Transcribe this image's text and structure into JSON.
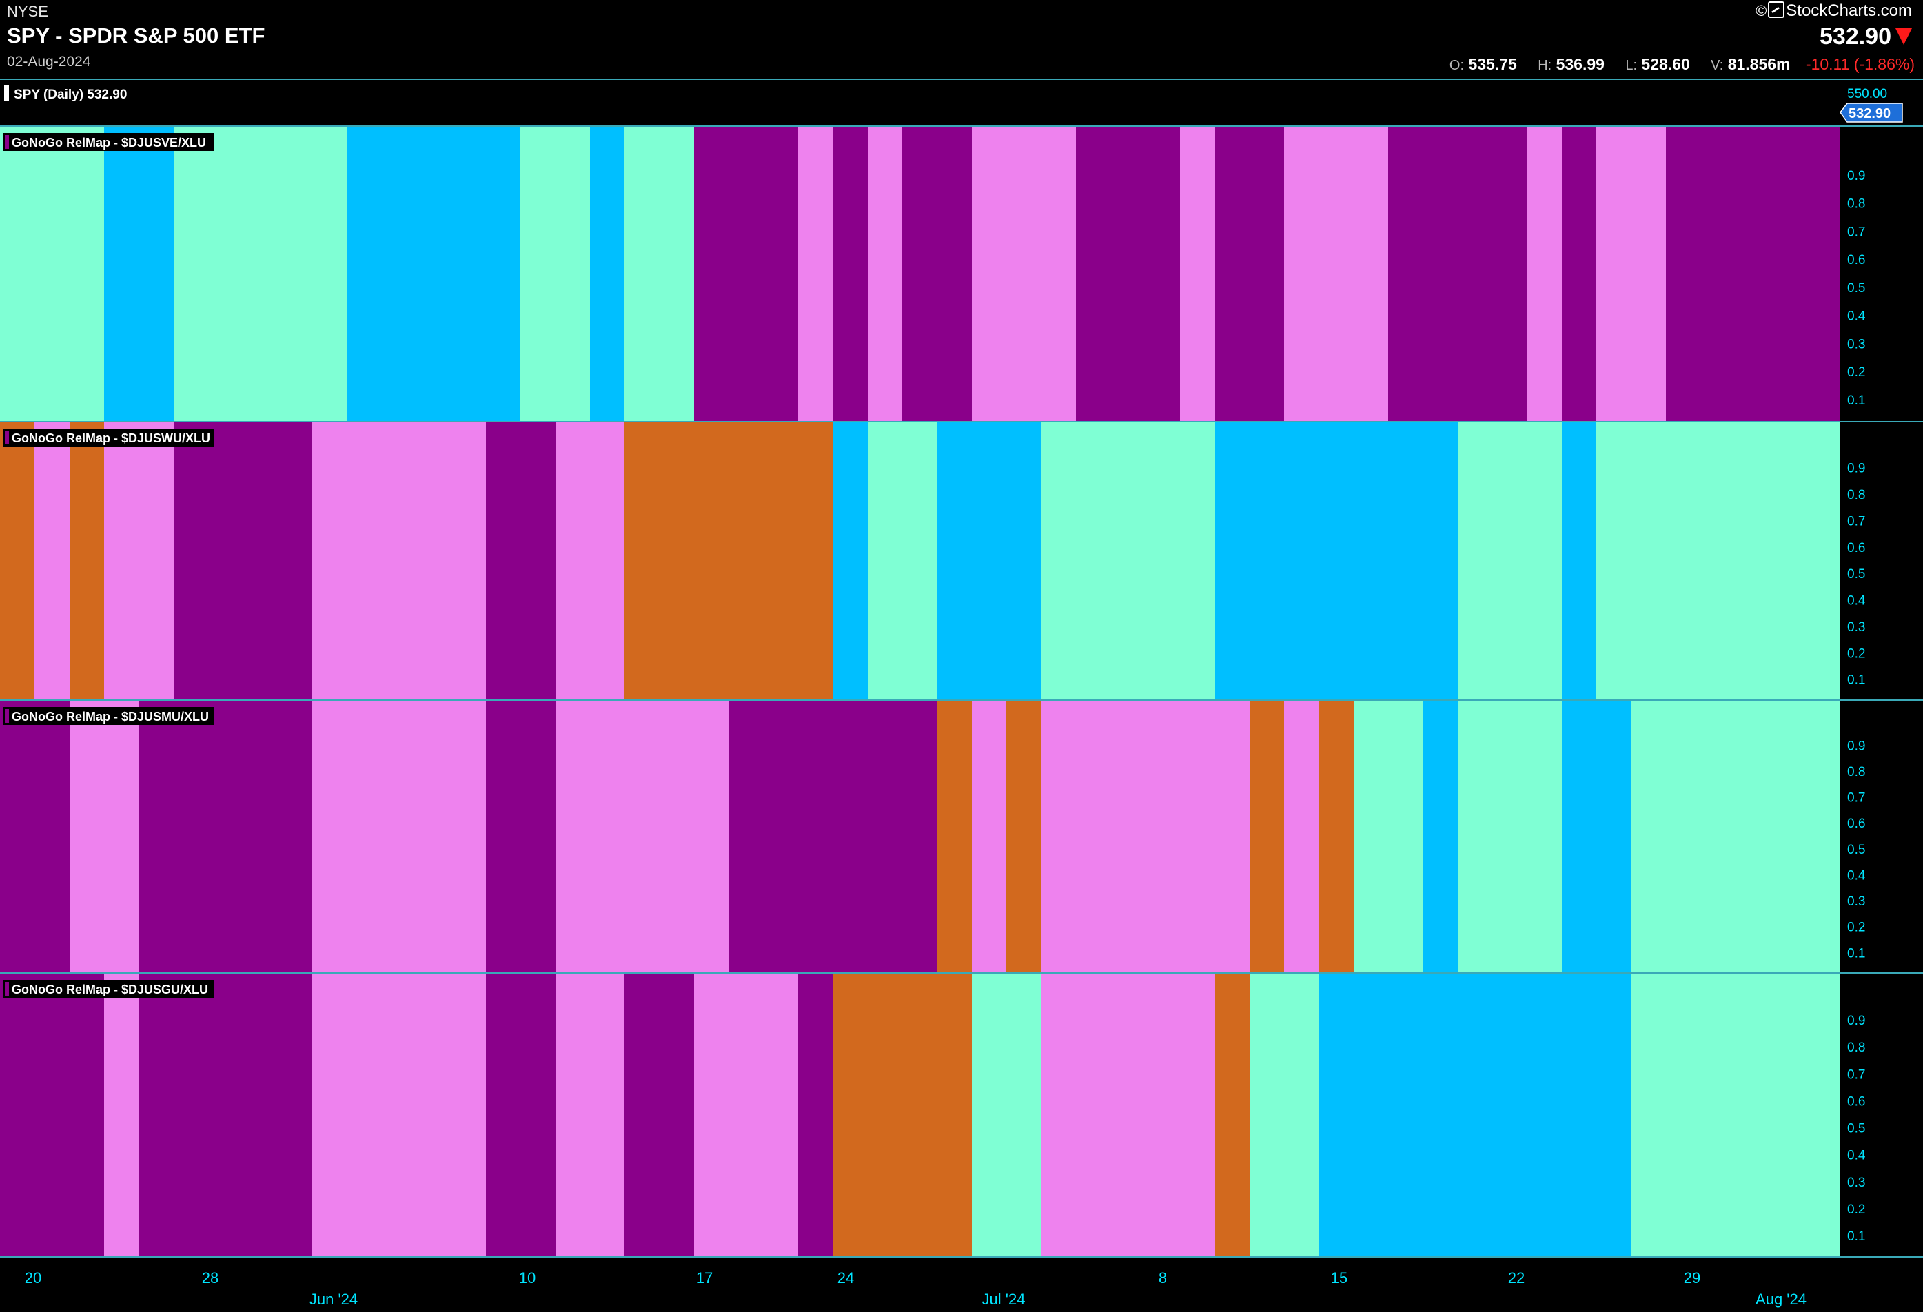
{
  "header": {
    "exchange": "NYSE",
    "title": "SPY - SPDR S&P 500 ETF",
    "date": "02-Aug-2024",
    "brand": "StockCharts.com",
    "last": "532.90",
    "open_label": "O:",
    "open": "535.75",
    "high_label": "H:",
    "high": "536.99",
    "low_label": "L:",
    "low": "528.60",
    "volume_label": "V:",
    "volume": "81.856m",
    "change": "-10.11 (-1.86%)"
  },
  "colors": {
    "purple": "#8a008a",
    "pink": "#ee82ee",
    "aqua": "#7fffd4",
    "blue": "#00bfff",
    "orange": "#d2691e",
    "axis_text": "#00e5ff",
    "price_tag": "#1e6fd9"
  },
  "chart_data": {
    "type": "heatmap",
    "price_panel": {
      "label": "SPY (Daily) 532.90",
      "axis_top": "550.00",
      "last_tag": "532.90"
    },
    "x_ticks": [
      "20",
      "28",
      "Jun '24",
      "10",
      "17",
      "24",
      "Jul '24",
      "8",
      "15",
      "22",
      "29",
      "Aug '24"
    ],
    "y_ticks": [
      "0.9",
      "0.8",
      "0.7",
      "0.6",
      "0.5",
      "0.4",
      "0.3",
      "0.2",
      "0.1"
    ],
    "panels": [
      {
        "name": "GoNoGo RelMap - $DJUSVE/XLU",
        "cells": [
          "aqua",
          "aqua",
          "aqua",
          "blue",
          "blue",
          "aqua",
          "aqua",
          "aqua",
          "aqua",
          "aqua",
          "blue",
          "blue",
          "blue",
          "blue",
          "blue",
          "aqua",
          "aqua",
          "blue",
          "aqua",
          "aqua",
          "purple",
          "purple",
          "purple",
          "pink",
          "purple",
          "pink",
          "purple",
          "purple",
          "pink",
          "pink",
          "pink",
          "purple",
          "purple",
          "purple",
          "pink",
          "purple",
          "purple",
          "pink",
          "pink",
          "pink",
          "purple",
          "purple",
          "purple",
          "purple",
          "pink",
          "purple",
          "pink",
          "pink",
          "purple",
          "purple",
          "purple",
          "purple",
          "purple"
        ]
      },
      {
        "name": "GoNoGo RelMap - $DJUSWU/XLU",
        "cells": [
          "orange",
          "pink",
          "orange",
          "pink",
          "pink",
          "purple",
          "purple",
          "purple",
          "purple",
          "pink",
          "pink",
          "pink",
          "pink",
          "pink",
          "purple",
          "purple",
          "pink",
          "pink",
          "orange",
          "orange",
          "orange",
          "orange",
          "orange",
          "orange",
          "blue",
          "aqua",
          "aqua",
          "blue",
          "blue",
          "blue",
          "aqua",
          "aqua",
          "aqua",
          "aqua",
          "aqua",
          "blue",
          "blue",
          "blue",
          "blue",
          "blue",
          "blue",
          "blue",
          "aqua",
          "aqua",
          "aqua",
          "blue",
          "aqua",
          "aqua",
          "aqua",
          "aqua",
          "aqua",
          "aqua",
          "aqua"
        ]
      },
      {
        "name": "GoNoGo RelMap - $DJUSMU/XLU",
        "cells": [
          "purple",
          "purple",
          "pink",
          "pink",
          "purple",
          "purple",
          "purple",
          "purple",
          "purple",
          "pink",
          "pink",
          "pink",
          "pink",
          "pink",
          "purple",
          "purple",
          "pink",
          "pink",
          "pink",
          "pink",
          "pink",
          "purple",
          "purple",
          "purple",
          "purple",
          "purple",
          "purple",
          "orange",
          "pink",
          "orange",
          "pink",
          "pink",
          "pink",
          "pink",
          "pink",
          "pink",
          "orange",
          "pink",
          "orange",
          "aqua",
          "aqua",
          "blue",
          "aqua",
          "aqua",
          "aqua",
          "blue",
          "blue",
          "aqua",
          "aqua",
          "aqua",
          "aqua",
          "aqua",
          "aqua"
        ]
      },
      {
        "name": "GoNoGo RelMap - $DJUSGU/XLU",
        "cells": [
          "purple",
          "purple",
          "purple",
          "pink",
          "purple",
          "purple",
          "purple",
          "purple",
          "purple",
          "pink",
          "pink",
          "pink",
          "pink",
          "pink",
          "purple",
          "purple",
          "pink",
          "pink",
          "purple",
          "purple",
          "pink",
          "pink",
          "pink",
          "purple",
          "orange",
          "orange",
          "orange",
          "orange",
          "aqua",
          "aqua",
          "pink",
          "pink",
          "pink",
          "pink",
          "pink",
          "orange",
          "aqua",
          "aqua",
          "blue",
          "blue",
          "blue",
          "blue",
          "blue",
          "blue",
          "blue",
          "blue",
          "blue",
          "aqua",
          "aqua",
          "aqua",
          "aqua",
          "aqua",
          "aqua"
        ]
      }
    ]
  }
}
